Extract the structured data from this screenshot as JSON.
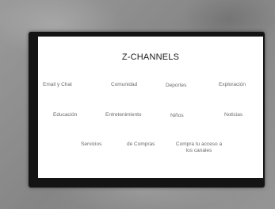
{
  "app": {
    "title": "Z-CHANNELS"
  },
  "menu": {
    "row1": [
      "Email y Chat",
      "Comunidad",
      "Deportes",
      "Exploración"
    ],
    "row2": [
      "Educación",
      "Entretenimiento",
      "Niños",
      "Noticias"
    ],
    "row3": [
      "Servicios",
      "de Compras",
      "Compra tu acceso a los canales"
    ]
  }
}
